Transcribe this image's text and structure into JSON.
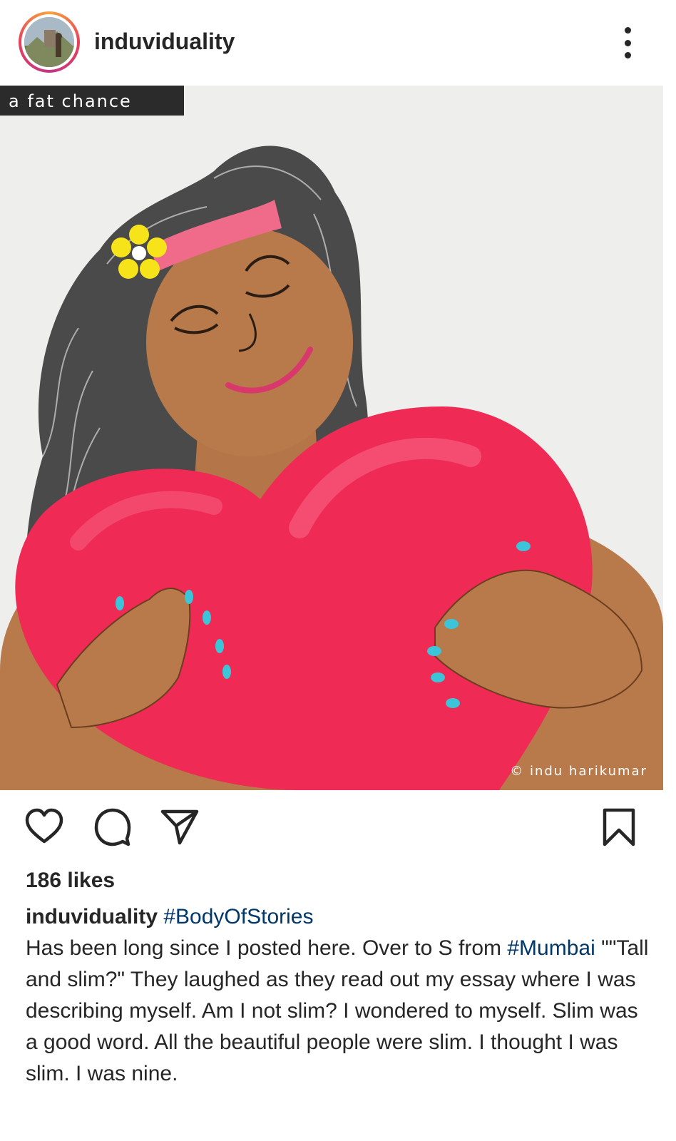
{
  "header": {
    "username": "induviduality",
    "more_icon": "more-vertical-icon"
  },
  "post": {
    "title_tag": "a fat chance",
    "credit": "© indu harikumar"
  },
  "actions": {
    "like_icon": "heart-icon",
    "comment_icon": "comment-icon",
    "share_icon": "send-icon",
    "save_icon": "bookmark-icon"
  },
  "likes": "186 likes",
  "caption": {
    "username": "induviduality",
    "hashtag_1": "#BodyOfStories",
    "text_1": "Has been long since I posted here. Over to S from ",
    "hashtag_2": "#Mumbai",
    "text_2": "\"\"Tall and slim?\" They laughed as they read out my essay where I was describing myself. Am I not slim? I wondered to myself. Slim was a good word. All the beautiful people were slim. I thought I was slim. I was nine."
  },
  "colors": {
    "hashtag": "#00376b",
    "text": "#262626",
    "heart_red": "#ef2a55",
    "skin": "#b87a4b"
  }
}
